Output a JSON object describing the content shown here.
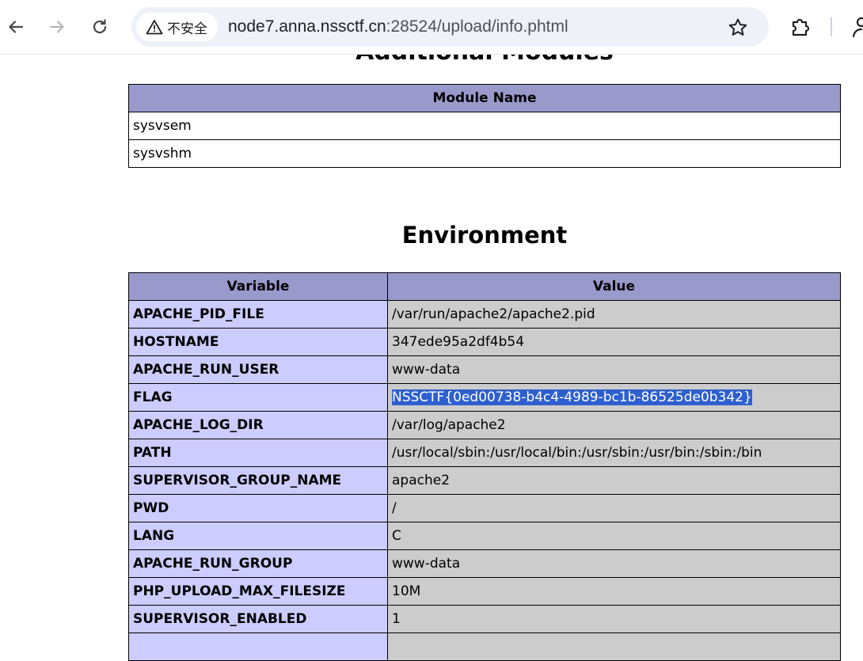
{
  "browser": {
    "security_label": "不安全",
    "url_host": "node7.anna.nssctf.cn",
    "url_rest": ":28524/upload/info.phtml"
  },
  "page": {
    "prev_section_title": "Additional Modules",
    "modules_table": {
      "header": "Module Name",
      "rows": [
        "sysvsem",
        "sysvshm"
      ]
    },
    "env_section_title": "Environment",
    "env_table": {
      "headers": [
        "Variable",
        "Value"
      ],
      "rows": [
        {
          "name": "APACHE_PID_FILE",
          "value": "/var/run/apache2/apache2.pid"
        },
        {
          "name": "HOSTNAME",
          "value": "347ede95a2df4b54"
        },
        {
          "name": "APACHE_RUN_USER",
          "value": "www-data"
        },
        {
          "name": "FLAG",
          "value": "NSSCTF{0ed00738-b4c4-4989-bc1b-86525de0b342}"
        },
        {
          "name": "APACHE_LOG_DIR",
          "value": "/var/log/apache2"
        },
        {
          "name": "PATH",
          "value": "/usr/local/sbin:/usr/local/bin:/usr/sbin:/usr/bin:/sbin:/bin"
        },
        {
          "name": "SUPERVISOR_GROUP_NAME",
          "value": "apache2"
        },
        {
          "name": "PWD",
          "value": "/"
        },
        {
          "name": "LANG",
          "value": "C"
        },
        {
          "name": "APACHE_RUN_GROUP",
          "value": "www-data"
        },
        {
          "name": "PHP_UPLOAD_MAX_FILESIZE",
          "value": "10M"
        },
        {
          "name": "SUPERVISOR_ENABLED",
          "value": "1"
        },
        {
          "name": "",
          "value": ""
        }
      ]
    }
  },
  "icons": {
    "back": "back-arrow-icon",
    "forward": "forward-arrow-icon",
    "reload": "reload-icon",
    "warning": "warning-triangle-icon",
    "bookmark": "star-icon",
    "extensions": "puzzle-icon",
    "profile": "profile-icon"
  },
  "colors": {
    "header_bg": "#9999cc",
    "var_bg": "#ccccff",
    "value_bg": "#cccccc",
    "selection": "#2f5fcf"
  }
}
